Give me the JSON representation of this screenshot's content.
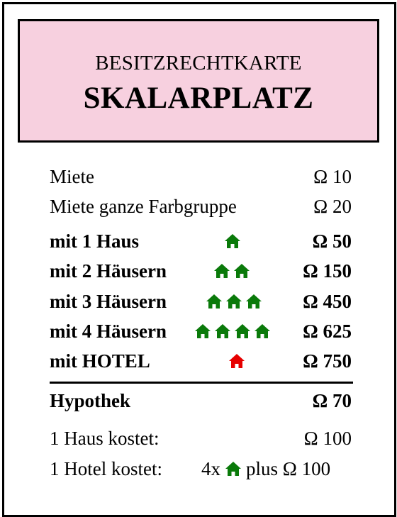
{
  "card": {
    "header_subtitle": "BESITZRECHTKARTE",
    "header_title": "SKALARPLATZ",
    "header_color": "#f7d0df"
  },
  "rent": [
    {
      "label": "Miete",
      "value": "Ω 10",
      "bold": false,
      "houses": 0
    },
    {
      "label": "Miete ganze Farbgruppe",
      "value": "Ω 20",
      "bold": false,
      "houses": 0
    },
    {
      "label": "mit 1 Haus",
      "value": "Ω 50",
      "bold": true,
      "houses": 1
    },
    {
      "label": "mit 2 Häusern",
      "value": "Ω 150",
      "bold": true,
      "houses": 2
    },
    {
      "label": "mit 3 Häusern",
      "value": "Ω 450",
      "bold": true,
      "houses": 3
    },
    {
      "label": "mit 4 Häusern",
      "value": "Ω 625",
      "bold": true,
      "houses": 4
    },
    {
      "label": "mit HOTEL",
      "value": "Ω 750",
      "bold": true,
      "hotel": true
    }
  ],
  "mortgage": {
    "label": "Hypothek",
    "value": "Ω 70"
  },
  "costs": {
    "house_label": "1 Haus kostet:",
    "house_value": "Ω 100",
    "hotel_label": "1 Hotel kostet:",
    "hotel_prefix": "4x",
    "hotel_suffix": "plus Ω 100"
  },
  "icons": {
    "house_icon": "house-icon",
    "hotel_icon": "hotel-icon",
    "house_color": "#0a7a0a",
    "hotel_color": "#e60000"
  }
}
